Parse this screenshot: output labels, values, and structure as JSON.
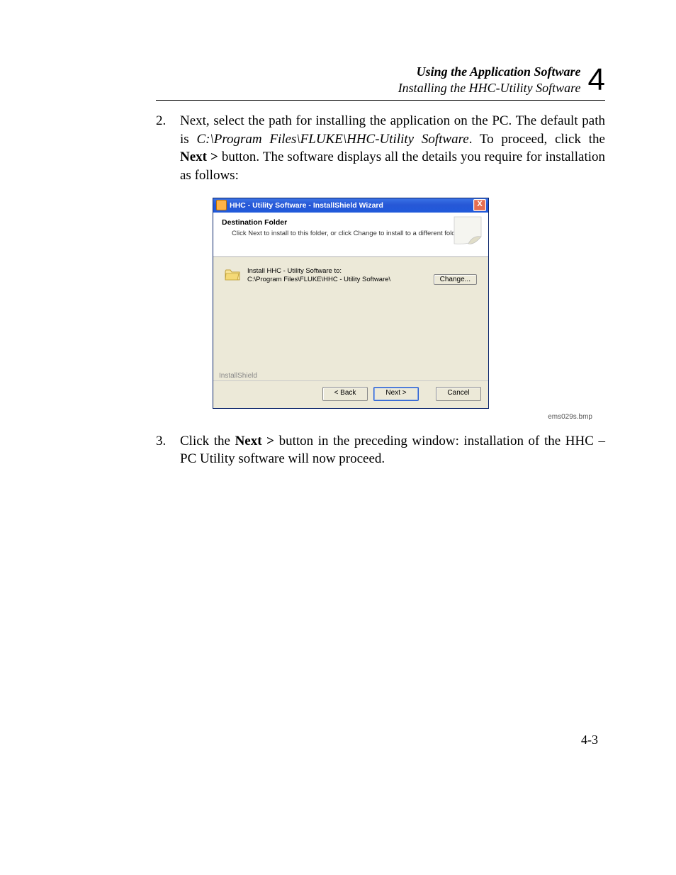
{
  "header": {
    "line1": "Using the Application Software",
    "line2": "Installing the HHC-Utility Software",
    "chapter": "4"
  },
  "step2": {
    "num": "2.",
    "pre": "Next, select the path for installing the application on the PC. The default path is ",
    "path": "C:\\Program Files\\FLUKE\\HHC-Utility Software",
    "mid": ". To proceed, click the ",
    "btn": "Next >",
    "post": " button. The software displays all the details you require for installation as follows:"
  },
  "dialog": {
    "title": "HHC - Utility Software - InstallShield Wizard",
    "close": "X",
    "banner_title": "Destination Folder",
    "banner_sub": "Click Next to install to this folder, or click Change to install to a different folder.",
    "install_line1": "Install HHC - Utility Software to:",
    "install_line2": "C:\\Program Files\\FLUKE\\HHC - Utility Software\\",
    "change_btn": "Change...",
    "brand": "InstallShield",
    "back": "< Back",
    "next": "Next >",
    "cancel": "Cancel"
  },
  "caption": "ems029s.bmp",
  "step3": {
    "num": "3.",
    "pre": "Click the ",
    "btn": "Next >",
    "post": " button in the preceding window: installation of the HHC – PC Utility software will now proceed."
  },
  "page_num": "4-3"
}
